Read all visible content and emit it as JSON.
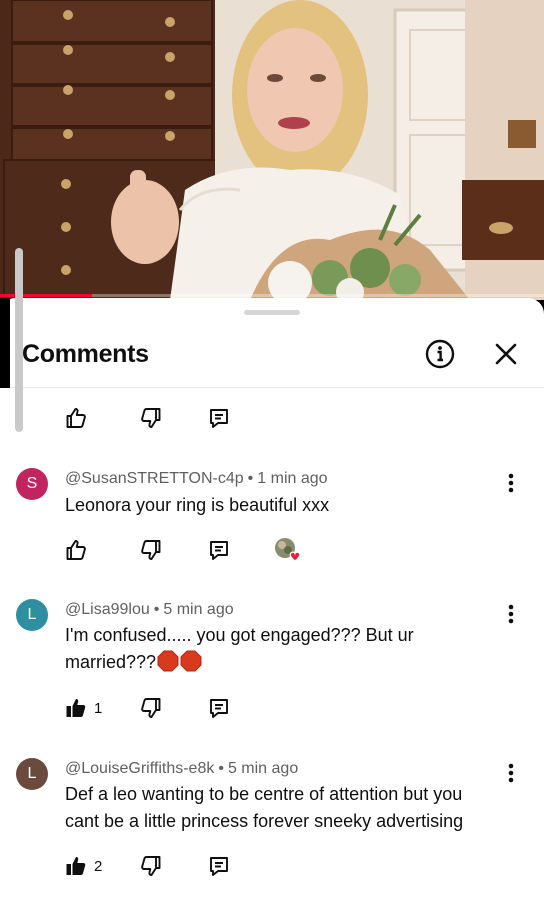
{
  "video": {
    "progress_percent": 17
  },
  "sheet": {
    "title": "Comments"
  },
  "comments": [
    {
      "avatar_letter": "S",
      "avatar_color": "#c0255f",
      "handle": "@SusanSTRETTON-c4p",
      "separator": "•",
      "time": "1 min ago",
      "text": "Leonora your ring is beautiful xxx",
      "like_count": "",
      "has_creator_heart": true
    },
    {
      "avatar_letter": "L",
      "avatar_color": "#2d8fa0",
      "handle": "@Lisa99lou",
      "separator": "•",
      "time": "5 min ago",
      "text_line1": "I'm confused..... you got engaged??? But ur",
      "text_line2": "married???",
      "emoji": "stop-sign",
      "like_count": "1"
    },
    {
      "avatar_letter": "L",
      "avatar_color": "#6a4a3c",
      "handle": "@LouiseGriffiths-e8k",
      "separator": "•",
      "time": "5 min ago",
      "text_line1": "Def a leo wanting to be centre of attention but you",
      "text_line2": "cant be a little princess forever sneeky advertising",
      "like_count": "2"
    }
  ],
  "icons": {
    "like": "thumbs-up-icon",
    "dislike": "thumbs-down-icon",
    "reply": "reply-icon",
    "info": "info-icon",
    "close": "close-icon",
    "more": "more-vert-icon"
  }
}
